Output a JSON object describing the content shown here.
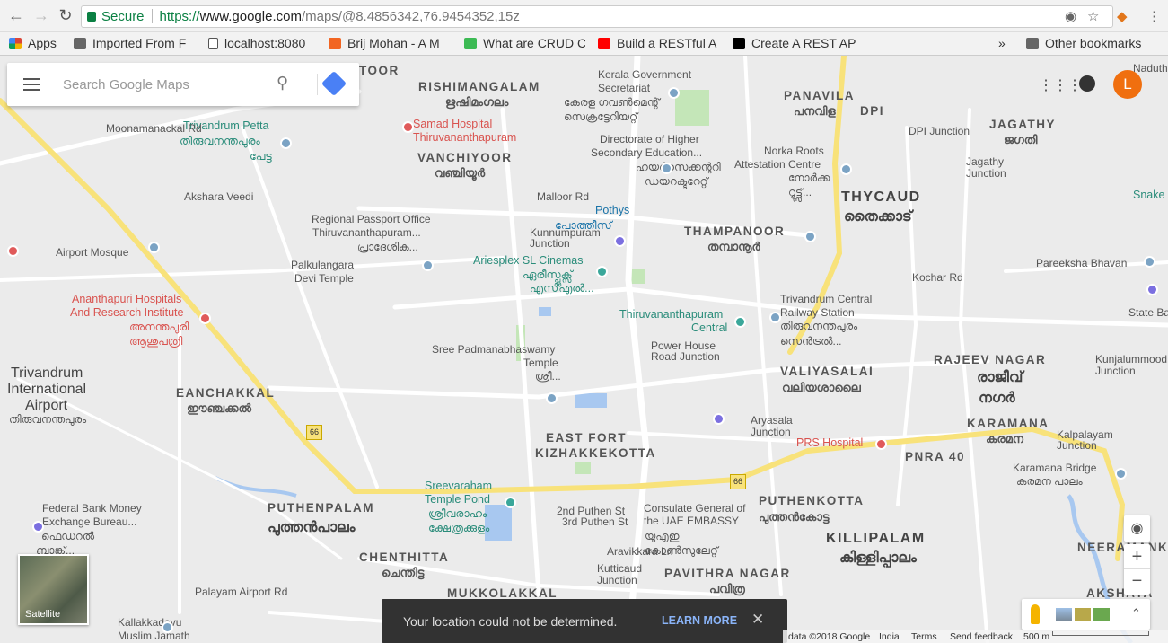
{
  "browser": {
    "secure_label": "Secure",
    "url_scheme": "https://",
    "url_host": "www.google.com",
    "url_path": "/maps/@8.4856342,76.9454352,15z",
    "bookmarks": [
      "Apps",
      "Imported From F",
      "localhost:8080",
      "Brij Mohan - A M",
      "What are CRUD C",
      "Build a RESTful A",
      "Create A REST AP"
    ],
    "overflow": "»",
    "other_bookmarks": "Other bookmarks"
  },
  "maps": {
    "search_placeholder": "Search Google Maps",
    "avatar_letter": "L",
    "satellite_label": "Satellite",
    "toast_message": "Your location could not be determined.",
    "toast_action": "LEARN MORE",
    "footer": {
      "data": "data ©2018 Google",
      "india": "India",
      "terms": "Terms",
      "feedback": "Send feedback",
      "scale": "500 m"
    },
    "zoom_in": "+",
    "zoom_out": "−",
    "highway_shield": "66",
    "labels": [
      "RISHIMANGALAM",
      "ഋഷിമംഗലം",
      "VANCHIYOOR",
      "വഞ്ചിയൂർ",
      "PANAVILA",
      "പനവിള",
      "DPI",
      "JAGATHY",
      "ജഗതി",
      "THYCAUD",
      "തൈക്കാട്",
      "THAMPANOOR",
      "തമ്പാനൂർ",
      "VALIYASALAI",
      "വലിയശാലൈ",
      "RAJEEV NAGAR",
      "രാജീവ്",
      "നഗർ",
      "KARAMANA",
      "കരമന",
      "PNRA 40",
      "EANCHAKKAL",
      "ഈഞ്ചക്കൽ",
      "EAST FORT",
      "KIZHAKKEKOTTA",
      "PUTHENPALAM",
      "പുത്തൻപാലം",
      "PUTHENKOTTA",
      "പുത്തൻകോട്ട",
      "KILLIPALAM",
      "കിള്ളിപ്പാലം",
      "CHENTHITTA",
      "ചെന്തിട്ട",
      "MUKKOLAKKAL",
      "PAVITHRA NAGAR",
      "പവിത്ര",
      "NEERAMANKARA",
      "AKSHAYA",
      "TOOR",
      "Trivandrum Petta",
      "തിരുവനന്തപുരം",
      "പേട്ട",
      "Regional Passport Office",
      "Thiruvananthapuram...",
      "പ്രാദേശിക...",
      "Airport Mosque",
      "Palkulangara",
      "Devi Temple",
      "Ariesplex SL Cinemas",
      "ഏരീസ്പ്ലക്സ്",
      "എസ്എൽ...",
      "Pothys",
      "പോത്തീസ്",
      "Kunnumpuram",
      "Junction",
      "Kerala Government",
      "Secretariat",
      "കേരള ഗവൺമെന്റ്",
      "സെക്രട്ടേറിയറ്റ്",
      "Directorate of Higher",
      "Secondary Education...",
      "ഹയർസെക്കന്ററി",
      "ഡയറക്ടറേറ്റ്",
      "Norka Roots",
      "Attestation Centre",
      "നോർക്ക",
      "റൂട്ട്സ്...",
      "Thiruvananthapuram",
      "Central",
      "Trivandrum Central",
      "Railway Station",
      "തിരുവനന്തപുരം",
      "സെൻട്രൽ...",
      "Power House",
      "Road Junction",
      "Sree Padmanabhaswamy",
      "Temple",
      "ശ്രീ...",
      "Aryasala",
      "Junction",
      "Sreevaraham",
      "Temple Pond",
      "ശ്രീവരാഹം",
      "ക്ഷേത്രക്കുളം",
      "Consulate General of",
      "the UAE EMBASSY",
      "യുഎഇ",
      "കോൺസുലേറ്റ്",
      "Federal Bank Money",
      "Exchange Bureau...",
      "ഫെഡറൽ",
      "ബാങ്ക്...",
      "Kutticaud",
      "Junction",
      "Pareeksha Bhavan",
      "State Ba",
      "Kunjalummood",
      "Junction",
      "Kalpalayam",
      "Junction",
      "Karamana Bridge",
      "കരമന പാലം",
      "Jagathy",
      "Junction",
      "DPI Junction",
      "Snake",
      "Naduthal",
      "Kallakkadavu",
      "Muslim Jamath",
      "Samad Hospital",
      "Thiruvananthapuram",
      "Ananthapuri Hospitals",
      "And Research Institute",
      "അനന്തപുരി",
      "ആശുപത്രി",
      "PRS Hospital",
      "Trivandrum",
      "International",
      "Airport",
      "തിരുവനന്തപുരം",
      "2nd Puthen St",
      "3rd Puthen St",
      "Moonamanackal Rd",
      "Akshara Veedi",
      "Malloor Rd",
      "Palayam Airport Rd",
      "Kochar Rd",
      "Aravikkara Ln"
    ]
  },
  "colors": {
    "highway": "#f8e27a",
    "road": "#ffffff",
    "water": "#a8c8f0",
    "park": "#c4e6b8",
    "bg": "#ebebeb"
  }
}
